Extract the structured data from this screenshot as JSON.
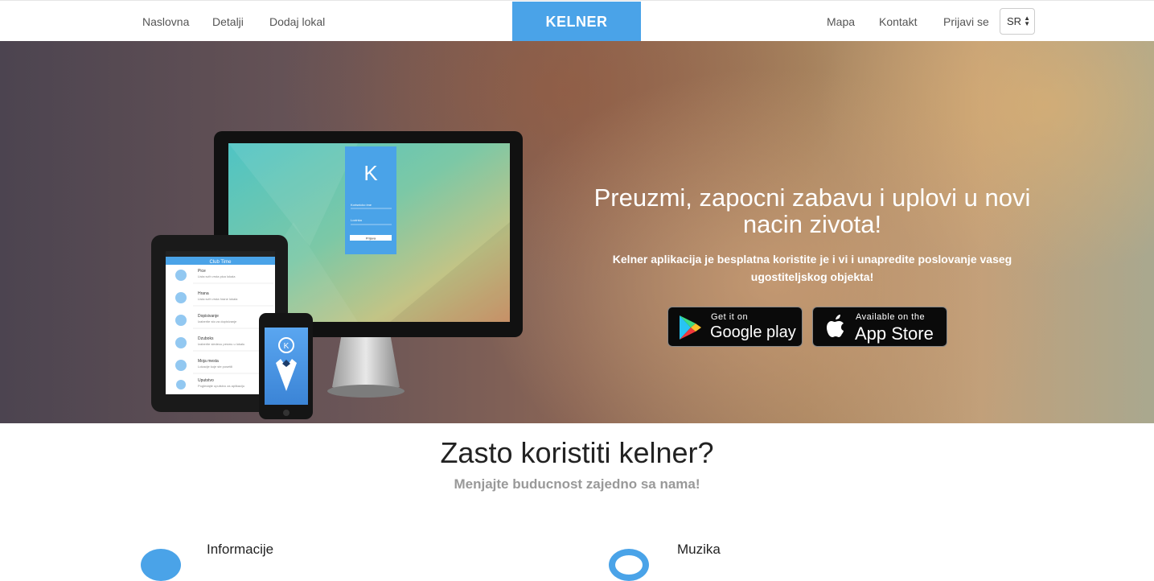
{
  "nav": {
    "left": [
      "Naslovna",
      "Detalji",
      "Dodaj lokal"
    ],
    "brand": "KELNER",
    "right": [
      "Mapa",
      "Kontakt",
      "Prijavi se"
    ],
    "language": "SR"
  },
  "hero": {
    "title_line1": "Preuzmi, zapocni zabavu i uplovi u novi",
    "title_line2": "nacin zivota!",
    "subtitle_line1": "Kelner aplikacija je besplatna koristite je i vi i unapredite poslovanje vaseg",
    "subtitle_line2": "ugostiteljskog objekta!",
    "google": {
      "small": "Get it on",
      "big": "Google play"
    },
    "apple": {
      "small": "Available on the",
      "big": "App Store"
    },
    "monitor_logo": "K",
    "monitor_field1": "Korisnicko ime",
    "monitor_field2": "Lozinka",
    "monitor_button": "Prijava",
    "tablet_header": "Club Time",
    "tablet_items": [
      {
        "title": "Pice",
        "sub": "Lista svih vrsta pica lokala"
      },
      {
        "title": "Hrana",
        "sub": "Lista svih vrsta hrane lokala"
      },
      {
        "title": "Dopisivanje",
        "sub": "Izaberite sto za dopisivanje"
      },
      {
        "title": "Dzuboks",
        "sub": "Izaberite sledecu pesmu u lokalu"
      },
      {
        "title": "Moja mesta",
        "sub": "Lokacije koje ste posetili"
      },
      {
        "title": "Uputstvo",
        "sub": "Pogledajte uputstvo za aplikaciju"
      }
    ]
  },
  "why": {
    "title": "Zasto koristiti kelner?",
    "subtitle": "Menjajte buducnost zajedno sa nama!",
    "features": [
      "Informacije",
      "Muzika"
    ]
  },
  "colors": {
    "accent": "#4aa3e8"
  }
}
